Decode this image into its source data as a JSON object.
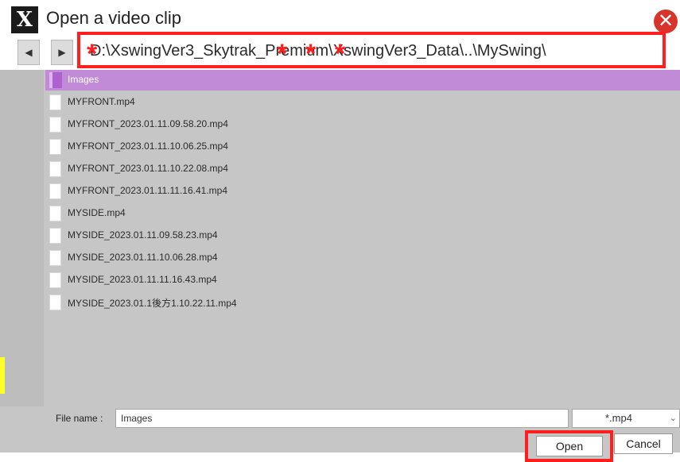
{
  "window": {
    "title": "Open a video clip",
    "logo_text": "X",
    "close_glyph": "✕"
  },
  "nav": {
    "back_glyph": "◀",
    "forward_glyph": "▶",
    "path": "D:\\XswingVer3_Skytrak_Premium\\XswingVer3_Data\\..\\MySwing\\",
    "mask_glyph": "*"
  },
  "files": [
    {
      "name": "Images",
      "type": "folder",
      "selected": true
    },
    {
      "name": "MYFRONT.mp4",
      "type": "file"
    },
    {
      "name": "MYFRONT_2023.01.11.09.58.20.mp4",
      "type": "file"
    },
    {
      "name": "MYFRONT_2023.01.11.10.06.25.mp4",
      "type": "file"
    },
    {
      "name": "MYFRONT_2023.01.11.10.22.08.mp4",
      "type": "file"
    },
    {
      "name": "MYFRONT_2023.01.11.11.16.41.mp4",
      "type": "file"
    },
    {
      "name": "MYSIDE.mp4",
      "type": "file"
    },
    {
      "name": "MYSIDE_2023.01.11.09.58.23.mp4",
      "type": "file"
    },
    {
      "name": "MYSIDE_2023.01.11.10.06.28.mp4",
      "type": "file"
    },
    {
      "name": "MYSIDE_2023.01.11.11.16.43.mp4",
      "type": "file"
    },
    {
      "name": "MYSIDE_2023.01.1後方1.10.22.11.mp4",
      "type": "file"
    }
  ],
  "bottom": {
    "file_name_label": "File name :",
    "file_name_value": "Images",
    "file_type": "*.mp4",
    "dropdown_glyph": "⌄",
    "open_label": "Open",
    "cancel_label": "Cancel"
  },
  "colors": {
    "highlight_box": "#ff1f1f",
    "selected_row": "#c28bd8",
    "folder_icon": "#ad62d0",
    "close_button": "#d9342b"
  }
}
